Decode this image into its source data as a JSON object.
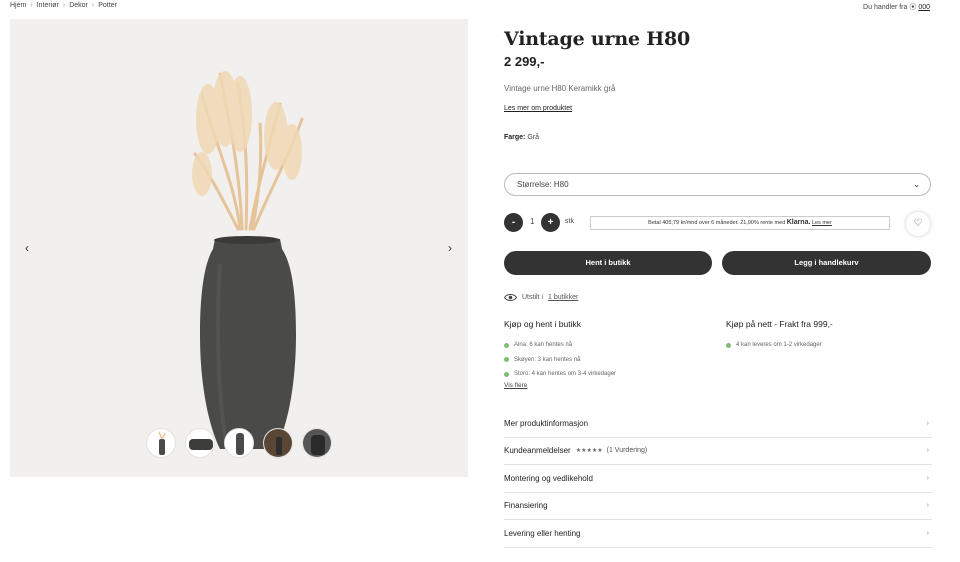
{
  "breadcrumb": [
    "Hjem",
    "Interiør",
    "Dekor",
    "Potter"
  ],
  "store": {
    "label": "Du handler fra",
    "value": "000"
  },
  "product": {
    "title": "Vintage urne H80",
    "price": "2 299,-",
    "subtitle": "Vintage urne H80 Keramikk grå",
    "read_more": "Les mer om produktet",
    "color_label": "Farge:",
    "color_value": "Grå",
    "size_select": "Størrelse: H80"
  },
  "quantity": {
    "minus": "-",
    "value": "1",
    "plus": "+",
    "unit": "stk"
  },
  "klarna": {
    "text": "Betal 405,79 kr/mnd over 6 måneder. 21,90% rente med",
    "brand": "Klarna.",
    "link": "Les mer"
  },
  "buttons": {
    "pickup": "Hent i butikk",
    "cart": "Legg i handlekurv"
  },
  "exhibited": {
    "label": "Utstilt i",
    "link": "1 butikker"
  },
  "pickup": {
    "title": "Kjøp og hent i butikk",
    "items": [
      "Alna: 6 kan hentes nå",
      "Skøyen: 3 kan hentes nå",
      "Storo: 4 kan hentes om 3-4 virkedager"
    ],
    "show_more": "Vis flere"
  },
  "online": {
    "title": "Kjøp på nett - Frakt fra 999,-",
    "items": [
      "4 kan leveres om 1-2 virkedager"
    ]
  },
  "accordion": [
    {
      "label": "Mer produktinformasjon"
    },
    {
      "label": "Kundeanmeldelser",
      "stars": "★★★★★",
      "count": "(1 Vurdering)"
    },
    {
      "label": "Montering og vedlikehold"
    },
    {
      "label": "Finansiering"
    },
    {
      "label": "Levering eller henting"
    }
  ],
  "icons": {
    "prev": "chevron-left-icon",
    "next": "chevron-right-icon",
    "heart": "heart-icon",
    "eye": "eye-icon"
  },
  "colors": {
    "dark_button": "#333333",
    "stock_green": "#7fbd73",
    "gallery_bg": "#f2f0ee"
  }
}
